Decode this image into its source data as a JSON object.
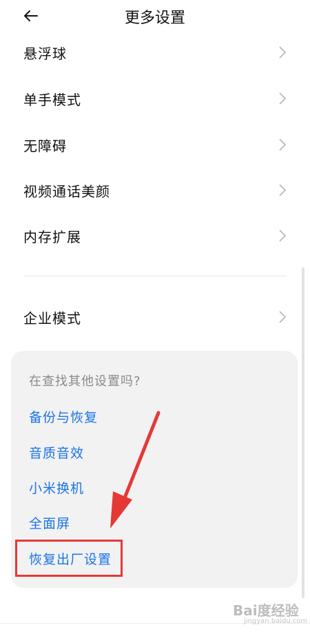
{
  "header": {
    "title": "更多设置"
  },
  "settings_items": [
    {
      "label": "悬浮球"
    },
    {
      "label": "单手模式"
    },
    {
      "label": "无障碍"
    },
    {
      "label": "视频通话美颜"
    },
    {
      "label": "内存扩展"
    },
    {
      "label": "企业模式"
    }
  ],
  "suggestions": {
    "title": "在查找其他设置吗?",
    "links": [
      {
        "label": "备份与恢复"
      },
      {
        "label": "音质音效"
      },
      {
        "label": "小米换机"
      },
      {
        "label": "全面屏"
      },
      {
        "label": "恢复出厂设置"
      }
    ]
  },
  "annotation": {
    "highlight_color": "#e53935"
  },
  "watermark": {
    "text": "Bai度经验",
    "sub": "jingyan.baidu.com"
  },
  "colors": {
    "link": "#1a73e8",
    "card_bg": "#f2f2f2"
  }
}
